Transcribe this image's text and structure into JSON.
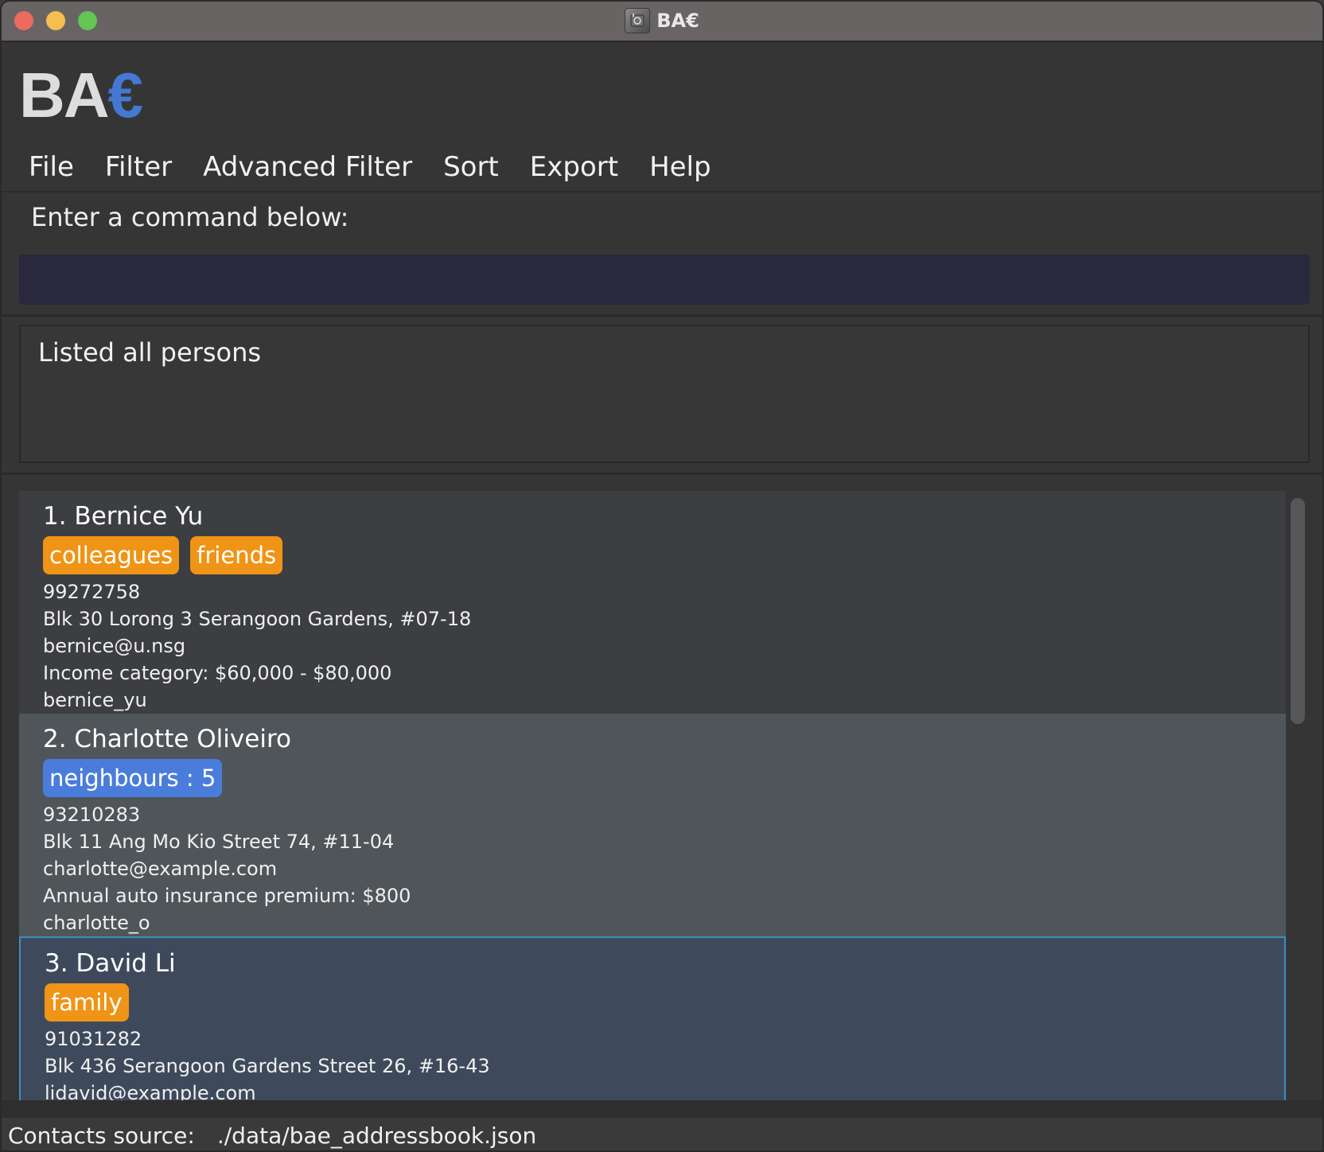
{
  "window": {
    "title": "BA€"
  },
  "logo": {
    "prefix": "BA",
    "accent": "€"
  },
  "menu": [
    "File",
    "Filter",
    "Advanced Filter",
    "Sort",
    "Export",
    "Help"
  ],
  "command": {
    "label": "Enter a command below:",
    "value": "",
    "placeholder": ""
  },
  "result": {
    "message": "Listed all persons"
  },
  "persons": [
    {
      "name": "1. Bernice Yu",
      "tags": [
        {
          "label": "colleagues",
          "color": "#ef9416"
        },
        {
          "label": "friends",
          "color": "#ef9416"
        }
      ],
      "phone": "99272758",
      "address": "Blk 30 Lorong 3 Serangoon Gardens, #07-18",
      "email": "bernice@u.nsg",
      "detail": "Income category: $60,000 - $80,000",
      "handle": "bernice_yu"
    },
    {
      "name": "2. Charlotte Oliveiro",
      "tags": [
        {
          "label": "neighbours : 5",
          "color": "#4a7ddb"
        }
      ],
      "phone": "93210283",
      "address": "Blk 11 Ang Mo Kio Street 74, #11-04",
      "email": "charlotte@example.com",
      "detail": "Annual auto insurance premium: $800",
      "handle": "charlotte_o"
    },
    {
      "name": "3. David Li",
      "tags": [
        {
          "label": "family",
          "color": "#ef9416"
        }
      ],
      "phone": "91031282",
      "address": "Blk 436 Serangoon Gardens Street 26, #16-43",
      "email": "lidavid@example.com",
      "selected": true
    }
  ],
  "status": {
    "label": "Contacts source:",
    "path": "./data/bae_addressbook.json"
  },
  "colors": {
    "accent": "#4478d3",
    "tag_orange": "#ef9416",
    "tag_blue": "#4a7ddb",
    "command_bg": "#29283c",
    "selected_border": "#3d8fbf"
  }
}
